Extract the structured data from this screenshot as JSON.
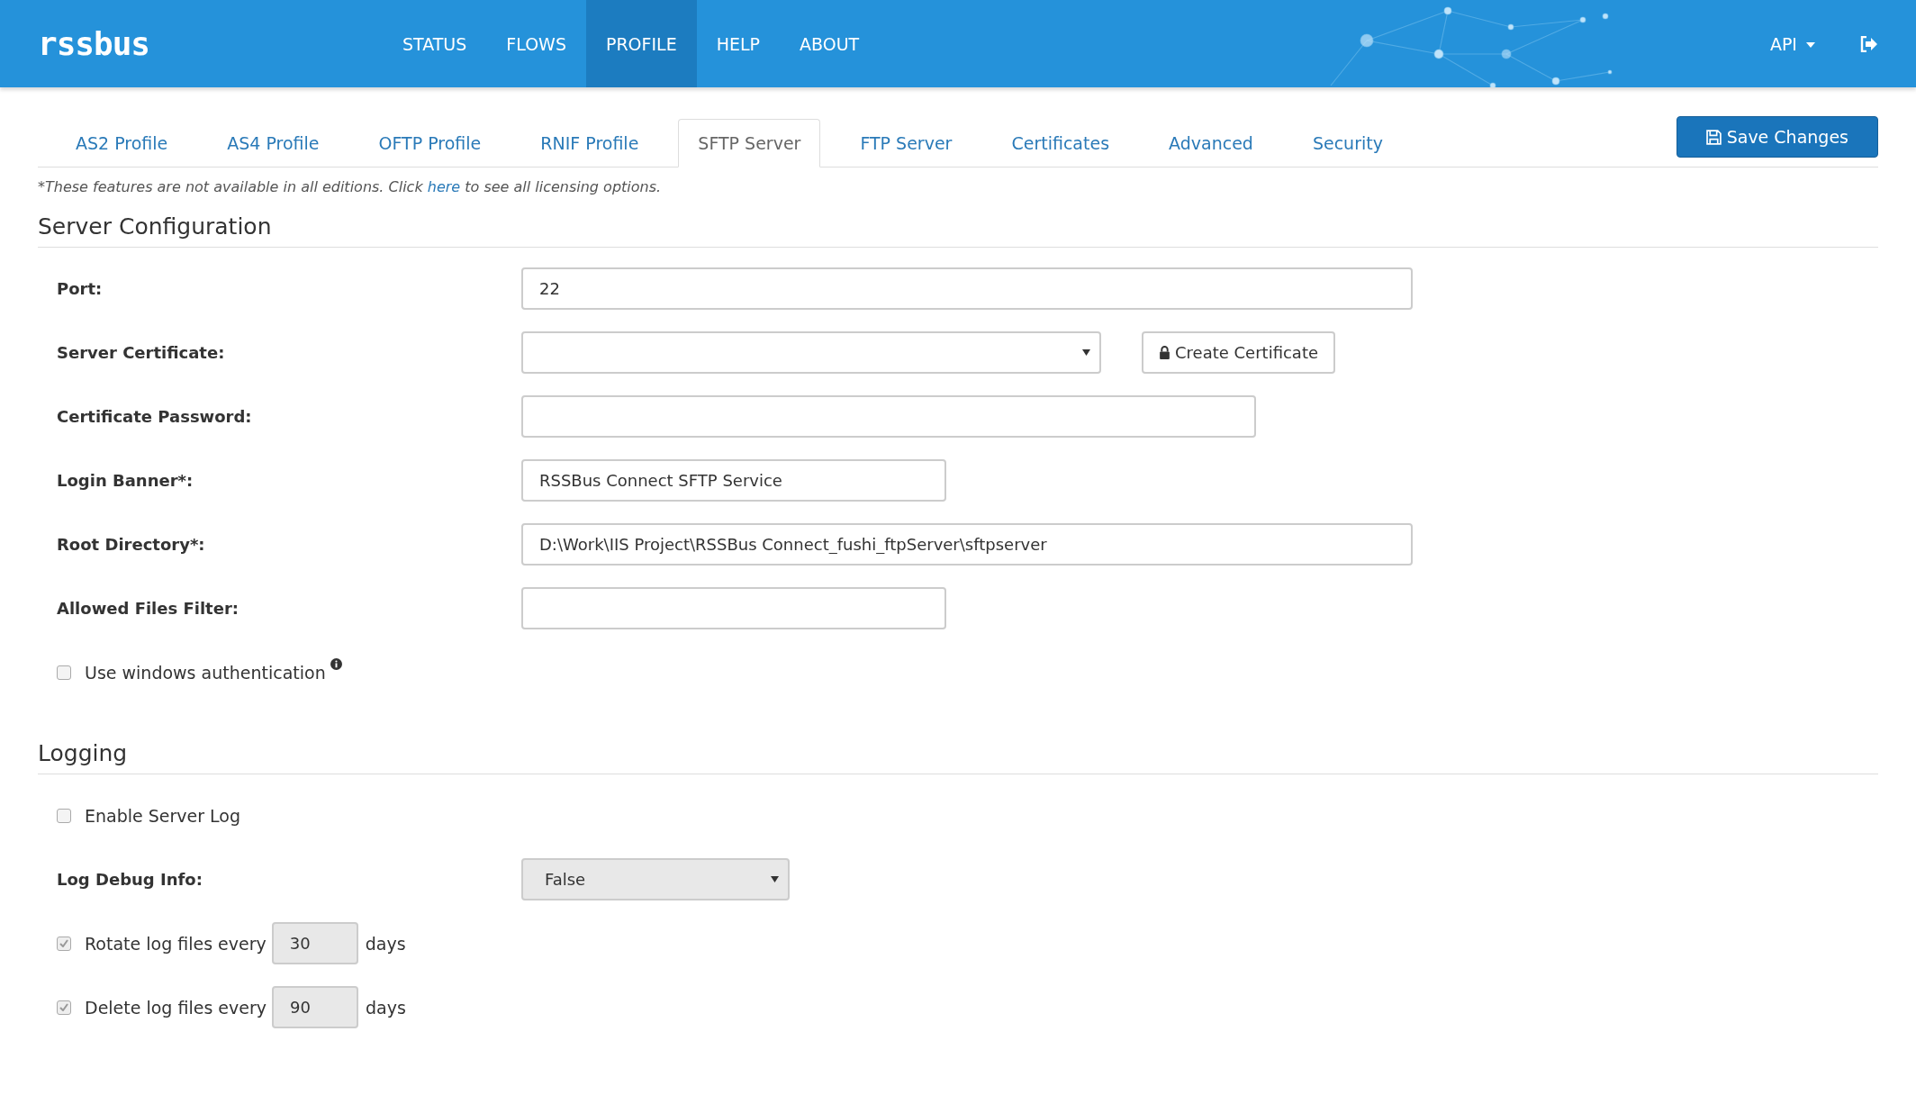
{
  "header": {
    "logo": "rssbus",
    "nav": [
      {
        "label": "STATUS",
        "selected": false
      },
      {
        "label": "FLOWS",
        "selected": false
      },
      {
        "label": "PROFILE",
        "selected": true
      },
      {
        "label": "HELP",
        "selected": false
      },
      {
        "label": "ABOUT",
        "selected": false
      }
    ],
    "api_menu": "API"
  },
  "tabs": [
    {
      "label": "AS2 Profile",
      "selected": false
    },
    {
      "label": "AS4 Profile",
      "selected": false
    },
    {
      "label": "OFTP Profile",
      "selected": false
    },
    {
      "label": "RNIF Profile",
      "selected": false
    },
    {
      "label": "SFTP Server",
      "selected": true
    },
    {
      "label": "FTP Server",
      "selected": false
    },
    {
      "label": "Certificates",
      "selected": false
    },
    {
      "label": "Advanced",
      "selected": false
    },
    {
      "label": "Security",
      "selected": false
    }
  ],
  "save_button": "Save Changes",
  "notice": {
    "before": "*These features are not available in all editions. Click ",
    "link": "here",
    "after": " to see all licensing options."
  },
  "sections": [
    {
      "title": "Server Configuration",
      "fields": [
        {
          "kind": "input",
          "label": "Port:",
          "value": "22"
        },
        {
          "kind": "select",
          "label": "Server Certificate:",
          "disabled": false,
          "button": "Create Certificate"
        },
        {
          "kind": "input",
          "label": "Certificate Password:"
        },
        {
          "kind": "input",
          "label": "Login Banner*:",
          "value": "RSSBus Connect SFTP Service"
        },
        {
          "kind": "input",
          "label": "Root Directory*:",
          "value": "D:\\Work\\IIS Project\\RSSBus Connect_fushi_ftpServer\\sftpserver"
        },
        {
          "kind": "input",
          "label": "Allowed Files Filter:"
        },
        {
          "kind": "checkbox",
          "label": "Use windows authentication",
          "checked": false,
          "info": true
        }
      ]
    },
    {
      "title": "Logging",
      "fields": [
        {
          "kind": "checkbox",
          "label": "Enable Server Log",
          "checked": false
        },
        {
          "kind": "select",
          "label": "Log Debug Info:",
          "value": "False",
          "disabled": true
        },
        {
          "kind": "interval",
          "label": "Rotate log files every",
          "value": "30",
          "unit": "days",
          "checked": true,
          "disabled": true
        },
        {
          "kind": "interval",
          "label": "Delete log files every",
          "value": "90",
          "unit": "days",
          "checked": true,
          "disabled": true
        }
      ]
    }
  ]
}
